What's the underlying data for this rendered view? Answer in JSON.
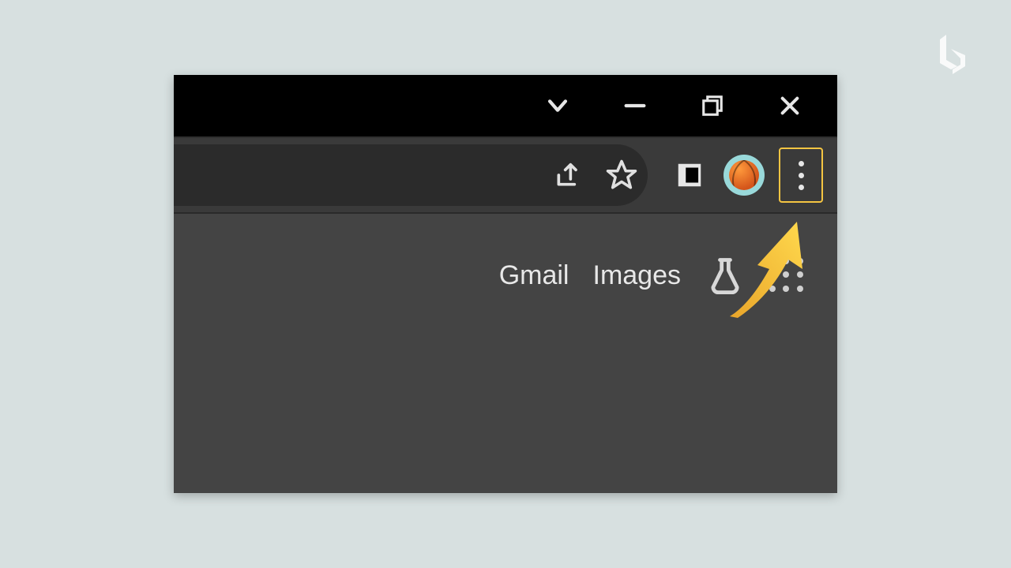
{
  "watermark": {
    "name": "b-logo"
  },
  "titlebar": {
    "icons": {
      "dropdown": "chevron-down-icon",
      "minimize": "minimize-icon",
      "maximize": "maximize-icon",
      "close": "close-icon"
    }
  },
  "toolbar": {
    "icons": {
      "share": "share-icon",
      "bookmark": "star-icon",
      "sidepanel": "side-panel-icon",
      "profile": "profile-avatar",
      "menu": "kebab-menu-icon"
    },
    "menu_highlight_color": "#f5c542"
  },
  "content": {
    "links": {
      "gmail": "Gmail",
      "images": "Images"
    },
    "icons": {
      "labs": "labs-icon",
      "apps": "apps-grid-icon"
    }
  },
  "annotation": {
    "arrow_name": "pointer-arrow",
    "arrow_color": "#f5c542"
  }
}
